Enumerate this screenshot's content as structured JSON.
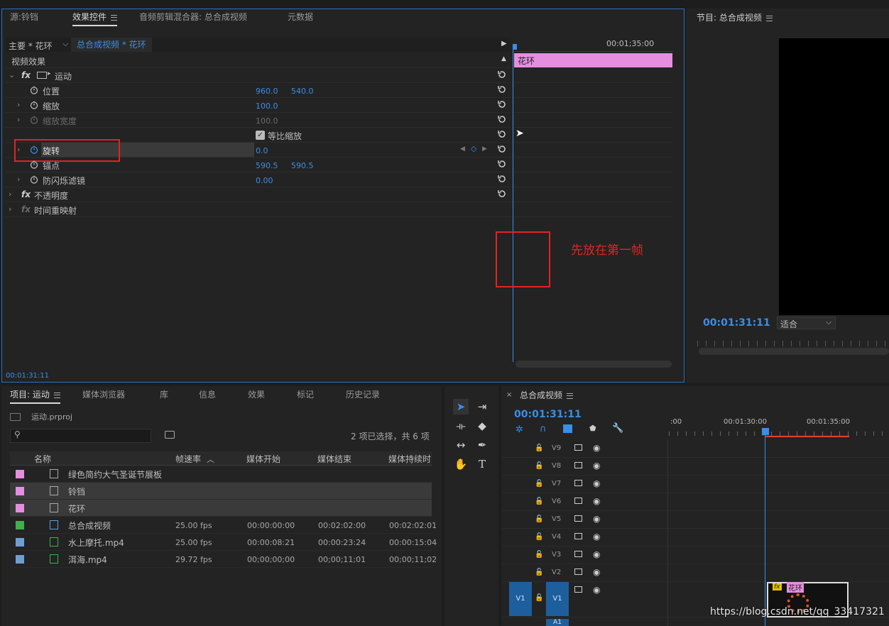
{
  "source_panel": {
    "tabs": [
      {
        "label": "源:铃铛"
      },
      {
        "label": "效果控件"
      },
      {
        "label": "音频剪辑混合器: 总合成视频"
      },
      {
        "label": "元数据"
      }
    ],
    "master_label": "主要 * 花环",
    "sequence_label": "总合成视频 * 花环",
    "section_label": "视频效果",
    "timecode_ruler": "00:01;35:00",
    "clip_label": "花环",
    "current_time": "00:01:31:11",
    "effects": {
      "motion": "运动",
      "position": {
        "label": "位置",
        "x": "960.0",
        "y": "540.0"
      },
      "scale": {
        "label": "缩放",
        "value": "100.0"
      },
      "scale_width": {
        "label": "缩放宽度",
        "value": "100.0"
      },
      "uniform_scale": "等比缩放",
      "rotation": {
        "label": "旋转",
        "value": "0.0"
      },
      "anchor": {
        "label": "锚点",
        "x": "590.5",
        "y": "590.5"
      },
      "flicker": {
        "label": "防闪烁滤镜",
        "value": "0.00"
      },
      "opacity": "不透明度",
      "time_remap": "时间重映射"
    },
    "fx_label": "fx"
  },
  "annotation": {
    "text": "先放在第一帧",
    "color": "#e52222"
  },
  "program_panel": {
    "title": "节目: 总合成视频",
    "timecode": "00:01:31:11",
    "fit_label": "适合"
  },
  "project_panel": {
    "tabs": [
      {
        "label": "项目: 运动"
      },
      {
        "label": "媒体浏览器"
      },
      {
        "label": "库"
      },
      {
        "label": "信息"
      },
      {
        "label": "效果"
      },
      {
        "label": "标记"
      },
      {
        "label": "历史记录"
      }
    ],
    "project_file": "运动.prproj",
    "search_placeholder": "",
    "selection_status": "2 项已选择，共 6 项",
    "columns": [
      "名称",
      "帧速率",
      "媒体开始",
      "媒体结束",
      "媒体持续时"
    ],
    "rows": [
      {
        "name": "绿色简约大气圣诞节展板",
        "fps": "",
        "start": "",
        "end": "",
        "dur": "",
        "color": "#e58ee0"
      },
      {
        "name": "铃铛",
        "fps": "",
        "start": "",
        "end": "",
        "dur": "",
        "color": "#e58ee0"
      },
      {
        "name": "花环",
        "fps": "",
        "start": "",
        "end": "",
        "dur": "",
        "color": "#e58ee0"
      },
      {
        "name": "总合成视频",
        "fps": "25.00 fps",
        "start": "00:00:00:00",
        "end": "00:02:02:00",
        "dur": "00:02:02:01",
        "color": "#3fb04a"
      },
      {
        "name": "水上摩托.mp4",
        "fps": "25.00 fps",
        "start": "00:00:08:21",
        "end": "00:00:23:24",
        "dur": "00:00:15:04",
        "color": "#6e9ed2"
      },
      {
        "name": "洱海.mp4",
        "fps": "29.72 fps",
        "start": "00;00;00;00",
        "end": "00;00;11;01",
        "dur": "00;00;11;02",
        "color": "#6e9ed2"
      }
    ]
  },
  "timeline_panel": {
    "title": "总合成视频",
    "timecode": "00:01:31:11",
    "ruler_labels": [
      ":00",
      "00:01:30:00",
      "00:01:35:00"
    ],
    "tracks": [
      "V9",
      "V8",
      "V7",
      "V6",
      "V5",
      "V4",
      "V3",
      "V2"
    ],
    "v1": "V1",
    "a1": "A1",
    "clip_label": "花环",
    "clip_fx": "fx"
  },
  "watermark": "https://blog.csdn.net/qq_33417321"
}
